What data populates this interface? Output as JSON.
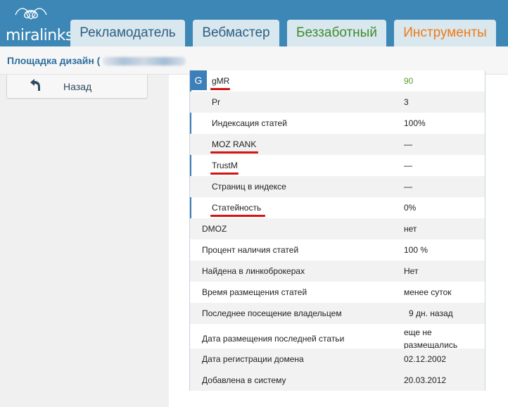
{
  "header": {
    "logo_text": "miralinks",
    "tabs": [
      {
        "label": "Рекламодатель"
      },
      {
        "label": "Вебмастер"
      },
      {
        "label": "Беззаботный"
      },
      {
        "label": "Инструменты"
      }
    ]
  },
  "subheader": {
    "site_title": "Площадка дизайн ("
  },
  "sidebar": {
    "back_label": "Назад"
  },
  "table": {
    "badge": "G",
    "rows": [
      {
        "label": "gMR",
        "value": "90"
      },
      {
        "label": "Pr",
        "value": "3"
      },
      {
        "label": "Индексация статей",
        "value": "100%"
      },
      {
        "label": "MOZ RANK",
        "value": "—"
      },
      {
        "label": "TrustM",
        "value": "—"
      },
      {
        "label": "Страниц в индексе",
        "value": "—"
      },
      {
        "label": "Статейность",
        "value": "0%"
      },
      {
        "label": "DMOZ",
        "value": "нет"
      },
      {
        "label": "Процент наличия статей",
        "value": "100 %"
      },
      {
        "label": "Найдена в линкоброкерах",
        "value": "Нет"
      },
      {
        "label": "Время размещения статей",
        "value": "менее суток"
      },
      {
        "label": "Последнее посещение владельцем",
        "value": "9 дн. назад"
      },
      {
        "label": "Дата размещения последней статьи",
        "value_line1": "еще не",
        "value_line2": "размещались"
      },
      {
        "label": "Дата регистрации домена",
        "value": "02.12.2002"
      },
      {
        "label": "Добавлена в систему",
        "value": "20.03.2012"
      }
    ]
  },
  "colors": {
    "header_bg": "#3d87b6",
    "tab_bg": "#d9e7ef",
    "advertiser_tab": "#2e5f82",
    "carefree_tab": "#3f8d2e",
    "tools_tab": "#f07a14",
    "highlight_underline": "#d41414",
    "gmr_value": "#5aa02c"
  },
  "icons": {
    "logo": "hands-heart-logo-icon",
    "back": "back-arrow-icon"
  }
}
